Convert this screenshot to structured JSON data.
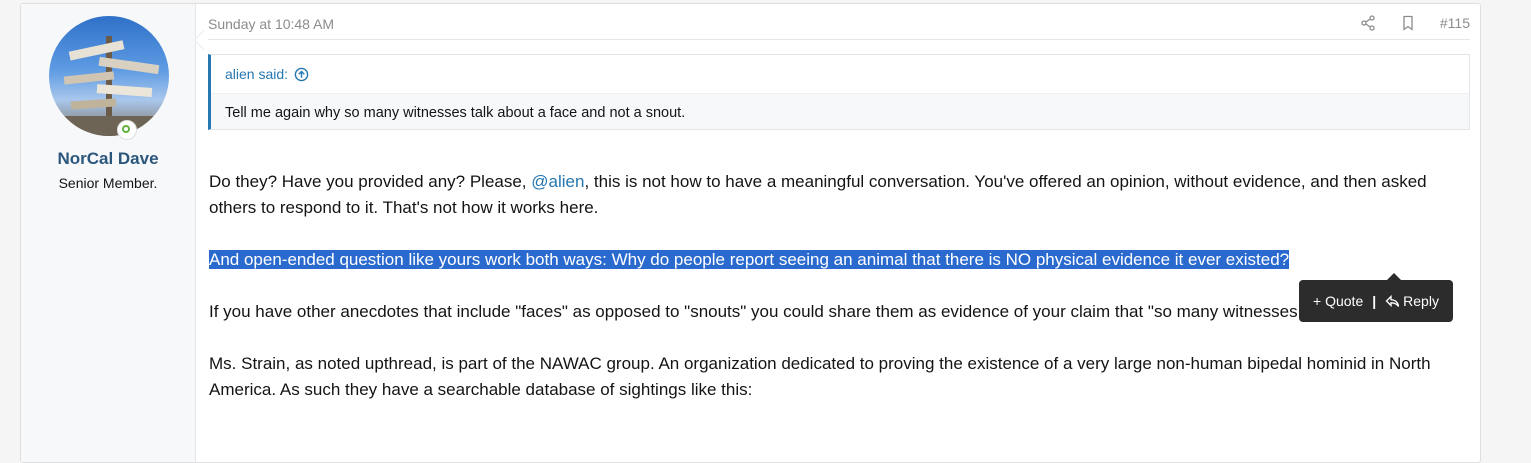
{
  "user": {
    "name": "NorCal Dave",
    "title": "Senior Member."
  },
  "post": {
    "date": "Sunday at 10:48 AM",
    "number": "#115",
    "actions": {
      "share_icon": "share-icon",
      "bookmark_icon": "bookmark-icon"
    }
  },
  "quote": {
    "author": "alien said:",
    "text": "Tell me again why so many witnesses talk about a face and not a snout."
  },
  "body": {
    "p1_a": "Do they? Have you provided any? Please, ",
    "p1_mention": "@alien",
    "p1_b": ", this is not how to have a meaningful conversation. You've offered an opinion, without evidence, and then asked others to respond to it. That's not how it works here.",
    "p2_selected": "And open-ended question like yours work both ways: Why do people report seeing an animal that there is NO physical evidence it ever existed?",
    "p3": "If you have other anecdotes that include \"faces\" as opposed to \"snouts\" you could share them as evidence of your claim that \"so many witnesses talk about a face\".",
    "p4": "Ms. Strain, as noted upthread, is part of the NAWAC group. An organization dedicated to proving the existence of a very large non-human bipedal hominid in North America. As such they have a searchable database of sightings like this:"
  },
  "selection_tooltip": {
    "quote_label": "+ Quote",
    "separator": "|",
    "reply_label": "Reply"
  },
  "colors": {
    "accent": "#2577b1",
    "username": "#2c577c",
    "selection": "#2a6acf",
    "online": "#63b141"
  }
}
